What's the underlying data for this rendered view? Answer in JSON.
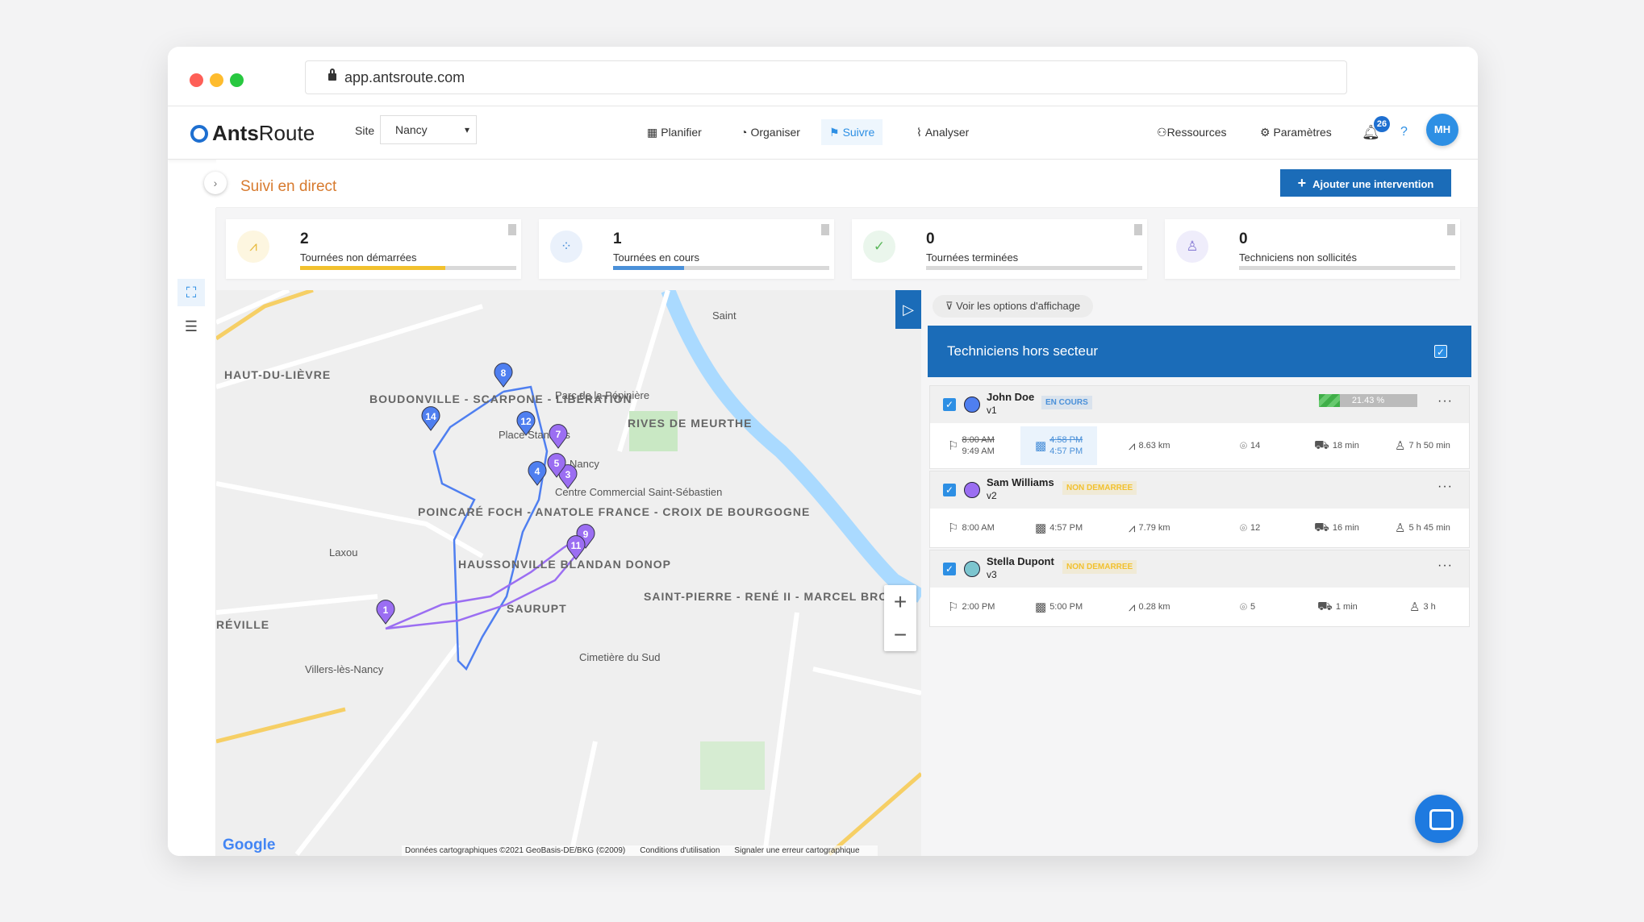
{
  "browser": {
    "url": "app.antsroute.com"
  },
  "header": {
    "logo_bold": "Ants",
    "logo_light": "Route",
    "site_label": "Site",
    "site_value": "Nancy",
    "nav": [
      {
        "label": "Planifier",
        "icon": "calendar-icon"
      },
      {
        "label": "Organiser",
        "icon": "gauge-icon"
      },
      {
        "label": "Suivre",
        "icon": "signpost-icon",
        "active": true
      },
      {
        "label": "Analyser",
        "icon": "chart-icon"
      }
    ],
    "resources": "Ressources",
    "settings": "Paramètres",
    "notifications": "26",
    "help": "?",
    "avatar": "MH"
  },
  "page": {
    "title": "Suivi en direct",
    "add_button": "Ajouter une intervention"
  },
  "stats": [
    {
      "value": "2",
      "label": "Tournées non démarrées",
      "progress": 0.67,
      "color": "#f2c12e",
      "icon": "road-icon"
    },
    {
      "value": "1",
      "label": "Tournées en cours",
      "progress": 0.33,
      "color": "#4a90d9",
      "icon": "spinner-icon"
    },
    {
      "value": "0",
      "label": "Tournées terminées",
      "progress": 0,
      "color": "#5cb85c",
      "icon": "check-circle-icon"
    },
    {
      "value": "0",
      "label": "Techniciens non sollicités",
      "progress": 0,
      "color": "#8a7fd6",
      "icon": "user-icon"
    }
  ],
  "map": {
    "labels": [
      "HAUT-DU-LIÈVRE",
      "BOUDONVILLE - SCARPONE - LIBÉRATION",
      "RIVES DE MEURTHE",
      "POINCARÉ FOCH - ANATOLE FRANCE - CROIX DE BOURGOGNE",
      "HAUSSONVILLE BLANDAN DONOP",
      "SAURUPT",
      "SAINT-PIERRE - RENÉ II - MARCEL BROT",
      "Parc de la Pépinière",
      "Nancy",
      "Centre Commercial Saint-Sébastien",
      "Laxou",
      "Villers-lès-Nancy",
      "Cimetière du Sud",
      "Place Stanislas",
      "RÉVILLE",
      "Saint"
    ],
    "markers": [
      "1",
      "3",
      "4",
      "5",
      "7",
      "8",
      "9",
      "11",
      "12",
      "14"
    ],
    "attribution": [
      "Données cartographiques ©2021 GeoBasis-DE/BKG (©2009)",
      "Conditions d'utilisation",
      "Signaler une erreur cartographique"
    ],
    "google": "Google"
  },
  "panel": {
    "options": "Voir les options d'affichage",
    "section": "Techniciens hors secteur",
    "technicians": [
      {
        "name": "John Doe",
        "vehicle": "v1",
        "status": "EN COURS",
        "status_color": "#4a90d9",
        "color": "#4f7ff0",
        "progress": "21.43 %",
        "progress_value": 0.2143,
        "start_planned": "8:00 AM",
        "start_actual": "9:49 AM",
        "end_planned": "4:58 PM",
        "end_actual": "4:57 PM",
        "distance": "8.63 km",
        "stops": "14",
        "drive": "18 min",
        "work": "7 h 50 min"
      },
      {
        "name": "Sam Williams",
        "vehicle": "v2",
        "status": "NON DEMARREE",
        "status_color": "#f2c12e",
        "color": "#9b6ef2",
        "start": "8:00 AM",
        "end": "4:57 PM",
        "distance": "7.79 km",
        "stops": "12",
        "drive": "16 min",
        "work": "5 h 45 min"
      },
      {
        "name": "Stella Dupont",
        "vehicle": "v3",
        "status": "NON DEMARREE",
        "status_color": "#f2c12e",
        "color": "#7cc5cf",
        "start": "2:00 PM",
        "end": "5:00 PM",
        "distance": "0.28 km",
        "stops": "5",
        "drive": "1 min",
        "work": "3 h"
      }
    ]
  }
}
